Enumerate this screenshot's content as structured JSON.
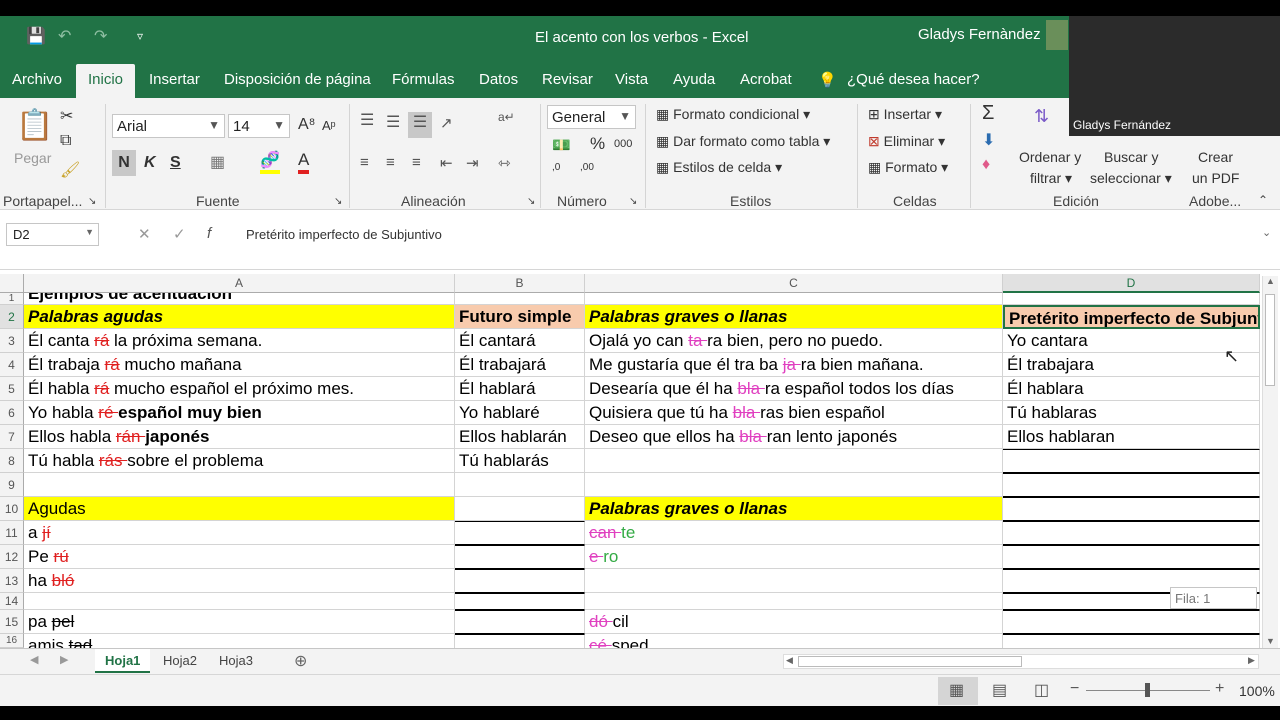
{
  "title": "El acento con los verbos  -  Excel",
  "user": "Gladys Fernàndez",
  "video_label": "Gladys Fernández",
  "tabs": [
    "Archivo",
    "Inicio",
    "Insertar",
    "Disposición de página",
    "Fórmulas",
    "Datos",
    "Revisar",
    "Vista",
    "Ayuda",
    "Acrobat",
    "¿Qué desea hacer?"
  ],
  "ribbon": {
    "paste": "Pegar",
    "font_name": "Arial",
    "font_size": "14",
    "bold": "N",
    "italic": "K",
    "underline": "S",
    "number_format": "General",
    "cond_format": "Formato condicional",
    "table_format": "Dar formato como tabla",
    "cell_styles": "Estilos de celda",
    "insert": "Insertar",
    "delete": "Eliminar",
    "format": "Formato",
    "sort1": "Ordenar y",
    "sort2": "filtrar",
    "find1": "Buscar y",
    "find2": "seleccionar",
    "pdf1": "Crear",
    "pdf2": "un PDF",
    "groups": [
      "Portapapel...",
      "Fuente",
      "Alineación",
      "Número",
      "Estilos",
      "Celdas",
      "Edición",
      "Adobe..."
    ]
  },
  "namebox": "D2",
  "formula": "Pretérito imperfecto de Subjuntivo",
  "columns": [
    "A",
    "B",
    "C",
    "D"
  ],
  "rows": [
    "1",
    "2",
    "3",
    "4",
    "5",
    "6",
    "7",
    "8",
    "9",
    "10",
    "11",
    "12",
    "13",
    "14",
    "15",
    "16"
  ],
  "cells": {
    "a1": "Ejemplos de acentuación",
    "a2": "Palabras agudas",
    "b2": "Futuro simple",
    "c2": "Palabras graves o llanas",
    "d2": "Pretérito imperfecto de Subjuntivo",
    "a3": [
      "Él canta ",
      "rá",
      " la próxima semana."
    ],
    "b3": "Él cantará",
    "c3": [
      "Ojalá yo can ",
      "ta ",
      "ra bien, pero no puedo."
    ],
    "d3": "Yo cantara",
    "a4": [
      "Él trabaja ",
      "rá",
      " mucho mañana"
    ],
    "b4": "Él trabajará",
    "c4": [
      "Me gustaría que él tra ba ",
      "ja ",
      "ra bien mañana."
    ],
    "d4": "Él trabajara",
    "a5": [
      "Él habla ",
      "rá",
      " mucho español el próximo mes."
    ],
    "b5": "Él hablará",
    "c5": [
      "Desearía que él ha ",
      "bla ",
      "ra español todos los días"
    ],
    "d5": "Él hablara",
    "a6": [
      "Yo habla ",
      "ré ",
      "español muy bien"
    ],
    "b6": "Yo hablaré",
    "c6": [
      "Quisiera que tú ha ",
      "bla ",
      "ras bien español"
    ],
    "d6": "Tú hablaras",
    "a7": [
      "Ellos habla ",
      "rán ",
      "japonés"
    ],
    "b7": "Ellos hablarán",
    "c7": [
      "Deseo que ellos ha ",
      "bla ",
      "ran lento japonés"
    ],
    "d7": "Ellos hablaran",
    "a8": [
      "Tú habla ",
      "rás ",
      "sobre el problema"
    ],
    "b8": "Tú hablarás",
    "a10": "Agudas",
    "c10": "Palabras graves o llanas",
    "a11": [
      "a ",
      "jí"
    ],
    "c11": [
      "can ",
      "te"
    ],
    "a12": [
      "Pe ",
      "rú"
    ],
    "c12": [
      "e ",
      "ro"
    ],
    "a13": [
      "ha ",
      "bló"
    ],
    "a15": [
      "pa ",
      "pel"
    ],
    "c15": [
      "dó ",
      "cil"
    ],
    "a16": [
      "amis ",
      "tad"
    ],
    "c16": [
      "cé ",
      "sped"
    ]
  },
  "sheets": [
    "Hoja1",
    "Hoja2",
    "Hoja3"
  ],
  "tooltip": "Fila: 1",
  "zoom": "100%",
  "colors": {
    "excel_green": "#217346",
    "yellow": "#ffff00",
    "peach": "#f8cbad",
    "strike_red": "#e02020",
    "magenta": "#e040c0"
  }
}
